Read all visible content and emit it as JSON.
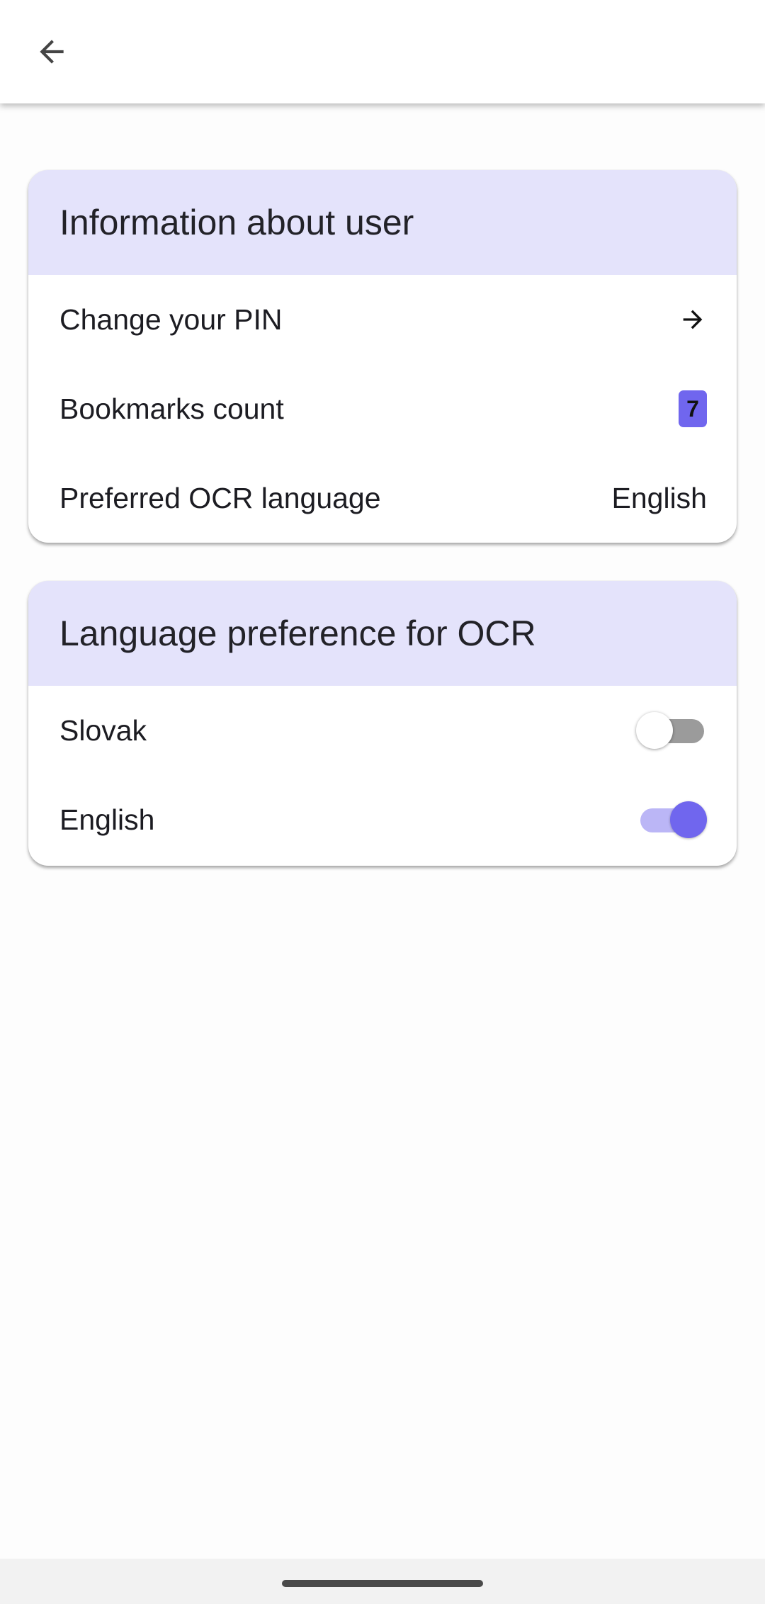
{
  "header": {
    "back_icon": "arrow-back-icon"
  },
  "user_info": {
    "title": "Information about user",
    "change_pin": {
      "label": "Change your PIN",
      "icon": "arrow-forward-icon"
    },
    "bookmarks": {
      "label": "Bookmarks count",
      "count": "7"
    },
    "ocr_language": {
      "label": "Preferred OCR language",
      "value": "English"
    }
  },
  "language_pref": {
    "title": "Language preference for OCR",
    "options": [
      {
        "label": "Slovak",
        "enabled": false
      },
      {
        "label": "English",
        "enabled": true
      }
    ]
  },
  "colors": {
    "accent": "#7066ee",
    "header_bg": "#e4e3fb",
    "switch_on_track": "#bbb6f6",
    "switch_off_track": "#9b9b9b"
  }
}
